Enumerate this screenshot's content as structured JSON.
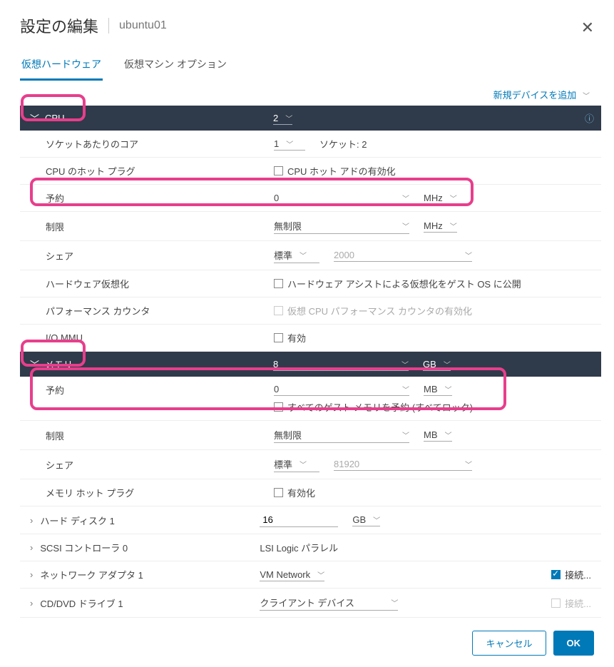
{
  "header": {
    "title": "設定の編集",
    "subtitle": "ubuntu01"
  },
  "tabs": {
    "hardware": "仮想ハードウェア",
    "options": "仮想マシン オプション"
  },
  "add_device": "新規デバイスを追加",
  "cpu": {
    "label": "CPU",
    "value": "2",
    "cores": {
      "label": "ソケットあたりのコア",
      "value": "1",
      "sockets": "ソケット: 2"
    },
    "hotplug": {
      "label": "CPU のホット プラグ",
      "check": "CPU ホット アドの有効化"
    },
    "reserve": {
      "label": "予約",
      "value": "0",
      "unit": "MHz"
    },
    "limit": {
      "label": "制限",
      "value": "無制限",
      "unit": "MHz"
    },
    "share": {
      "label": "シェア",
      "level": "標準",
      "value": "2000"
    },
    "hwvirt": {
      "label": "ハードウェア仮想化",
      "check": "ハードウェア アシストによる仮想化をゲスト OS に公開"
    },
    "perfcnt": {
      "label": "パフォーマンス カウンタ",
      "check": "仮想 CPU パフォーマンス カウンタの有効化"
    },
    "iommu": {
      "label": "I/O MMU",
      "check": "有効"
    }
  },
  "mem": {
    "label": "メモリ",
    "value": "8",
    "unit": "GB",
    "reserve": {
      "label": "予約",
      "value": "0",
      "unit": "MB",
      "lockall": "すべてのゲスト メモリを予約 (すべてロック)"
    },
    "limit": {
      "label": "制限",
      "value": "無制限",
      "unit": "MB"
    },
    "share": {
      "label": "シェア",
      "level": "標準",
      "value": "81920"
    },
    "hotplug": {
      "label": "メモリ ホット プラグ",
      "check": "有効化"
    }
  },
  "hdd": {
    "label": "ハード ディスク 1",
    "value": "16",
    "unit": "GB"
  },
  "scsi": {
    "label": "SCSI コントローラ 0",
    "value": "LSI Logic パラレル"
  },
  "net": {
    "label": "ネットワーク アダプタ 1",
    "value": "VM Network",
    "connect": "接続..."
  },
  "cd": {
    "label": "CD/DVD ドライブ 1",
    "value": "クライアント デバイス",
    "connect": "接続..."
  },
  "buttons": {
    "cancel": "キャンセル",
    "ok": "OK"
  }
}
